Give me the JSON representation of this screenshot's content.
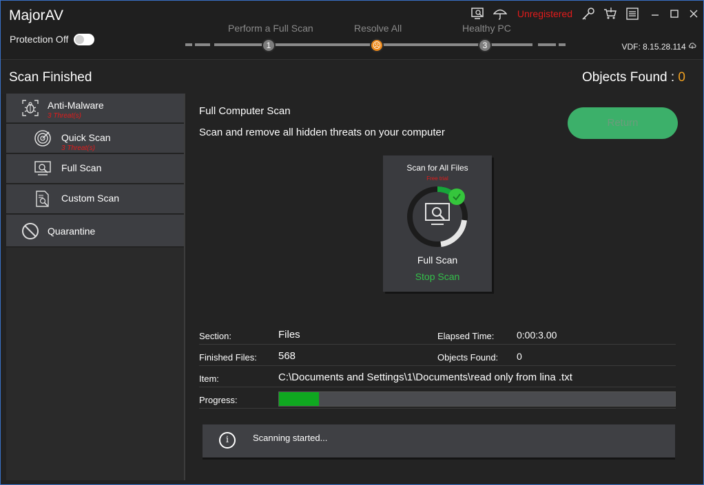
{
  "app": {
    "title": "MajorAV",
    "protection_label": "Protection Off",
    "status": "Unregistered",
    "vdf": "VDF: 8.15.28.114"
  },
  "steps": [
    {
      "label": "Perform a Full Scan",
      "number": "1"
    },
    {
      "label": "Resolve All",
      "number": "☹"
    },
    {
      "label": "Healthy PC",
      "number": "3"
    }
  ],
  "header": {
    "title": "Scan Finished",
    "objects_label": "Objects Found :",
    "objects_count": "0"
  },
  "sidebar": {
    "anti_malware": {
      "label": "Anti-Malware",
      "sub": "3 Threat(s)"
    },
    "quick_scan": {
      "label": "Quick Scan",
      "sub": "3 Threat(s)"
    },
    "full_scan": {
      "label": "Full Scan"
    },
    "custom_scan": {
      "label": "Custom Scan"
    },
    "quarantine": {
      "label": "Quarantine"
    }
  },
  "main": {
    "title": "Full Computer Scan",
    "description": "Scan and remove all hidden threats on your computer",
    "return_label": "Return",
    "card": {
      "title": "Scan for All Files",
      "trial": "Free trial",
      "name": "Full Scan",
      "stop": "Stop Scan"
    },
    "info": {
      "section_label": "Section:",
      "section_value": "Files",
      "elapsed_label": "Elapsed Time:",
      "elapsed_value": "0:00:3.00",
      "finished_label": "Finished Files:",
      "finished_value": "568",
      "objects_label": "Objects Found:",
      "objects_value": "0",
      "item_label": "Item:",
      "item_value": "C:\\Documents and Settings\\1\\Documents\\read only from lina .txt",
      "progress_label": "Progress:",
      "progress_fraction": 0.1
    },
    "log_message": "Scanning started..."
  },
  "colors": {
    "accent_orange": "#ef8a1b",
    "return_green": "#3cb06a",
    "progress_green": "#0fa820",
    "warning_red": "#e31b1b"
  }
}
